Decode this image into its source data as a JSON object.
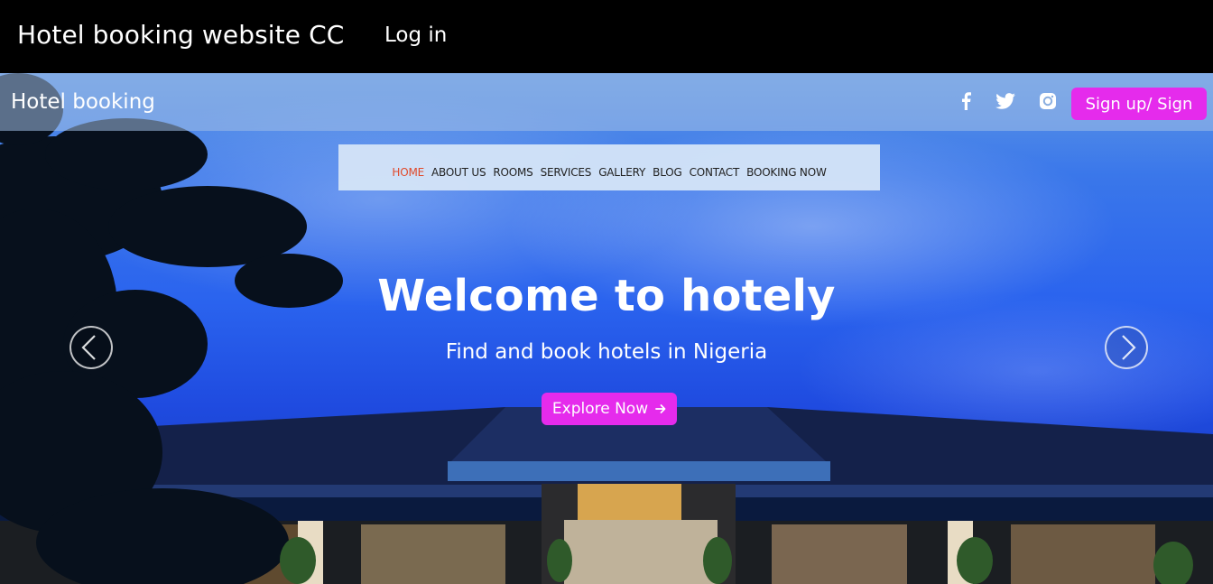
{
  "topbar": {
    "brand": "Hotel booking website CC",
    "login": "Log in"
  },
  "subnav": {
    "title": "Hotel booking",
    "social_icons": [
      "facebook-icon",
      "twitter-icon",
      "instagram-icon"
    ],
    "signup_label": "Sign up/ Sign"
  },
  "menu": {
    "items": [
      "HOME",
      "ABOUT US",
      "ROOMS",
      "SERVICES",
      "GALLERY",
      "BLOG",
      "CONTACT",
      "BOOKING NOW"
    ],
    "active": "HOME"
  },
  "hero": {
    "headline": "Welcome to hotely",
    "subline": "Find and book hotels in Nigeria",
    "cta_label": "Explore Now",
    "cta_icon": "arrow-right-icon"
  },
  "colors": {
    "accent": "#e52bec",
    "active_menu": "#e0492a"
  }
}
